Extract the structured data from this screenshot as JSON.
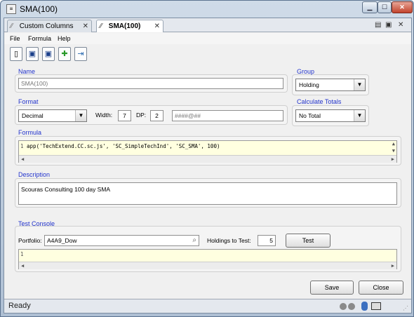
{
  "window": {
    "title": "SMA(100)",
    "icon_glyph": "≡",
    "min_glyph": "▁",
    "max_glyph": "☐",
    "close_glyph": "✕"
  },
  "tabs": [
    {
      "label": "Custom Columns",
      "close": "✕"
    },
    {
      "label": "SMA(100)",
      "close": "✕"
    }
  ],
  "tab_grip": "⁄⁄",
  "tab_icons": {
    "a": "▤",
    "b": "▣",
    "close": "✕"
  },
  "menu": [
    "File",
    "Formula",
    "Help"
  ],
  "toolbar": {
    "new": "▯",
    "save": "▣",
    "saveas": "▣",
    "add": "✚",
    "export": "⇥"
  },
  "name": {
    "label": "Name",
    "value": "SMA(100)"
  },
  "group": {
    "label": "Group",
    "value": "Holding"
  },
  "format": {
    "label": "Format",
    "value": "Decimal",
    "width_label": "Width:",
    "width": "7",
    "dp_label": "DP:",
    "dp": "2",
    "pattern_placeholder": "####@##"
  },
  "totals": {
    "label": "Calculate Totals",
    "value": "No Total"
  },
  "formula": {
    "label": "Formula",
    "line": "1",
    "code": "app('TechExtend.CC.sc.js', 'SC_SimpleTechInd', 'SC_SMA', 100)"
  },
  "description": {
    "label": "Description",
    "value": "Scouras Consulting 100 day SMA"
  },
  "console": {
    "label": "Test Console",
    "portfolio_label": "Portfolio:",
    "portfolio": "A4A9_Dow",
    "holdings_label": "Holdings to Test:",
    "holdings": "5",
    "test": "Test",
    "line": "1"
  },
  "buttons": {
    "save": "Save",
    "close": "Close"
  },
  "status": {
    "text": "Ready"
  },
  "arrows": {
    "down": "▼",
    "left": "◀",
    "right": "▶",
    "up": "▲",
    "dn": "▼"
  }
}
